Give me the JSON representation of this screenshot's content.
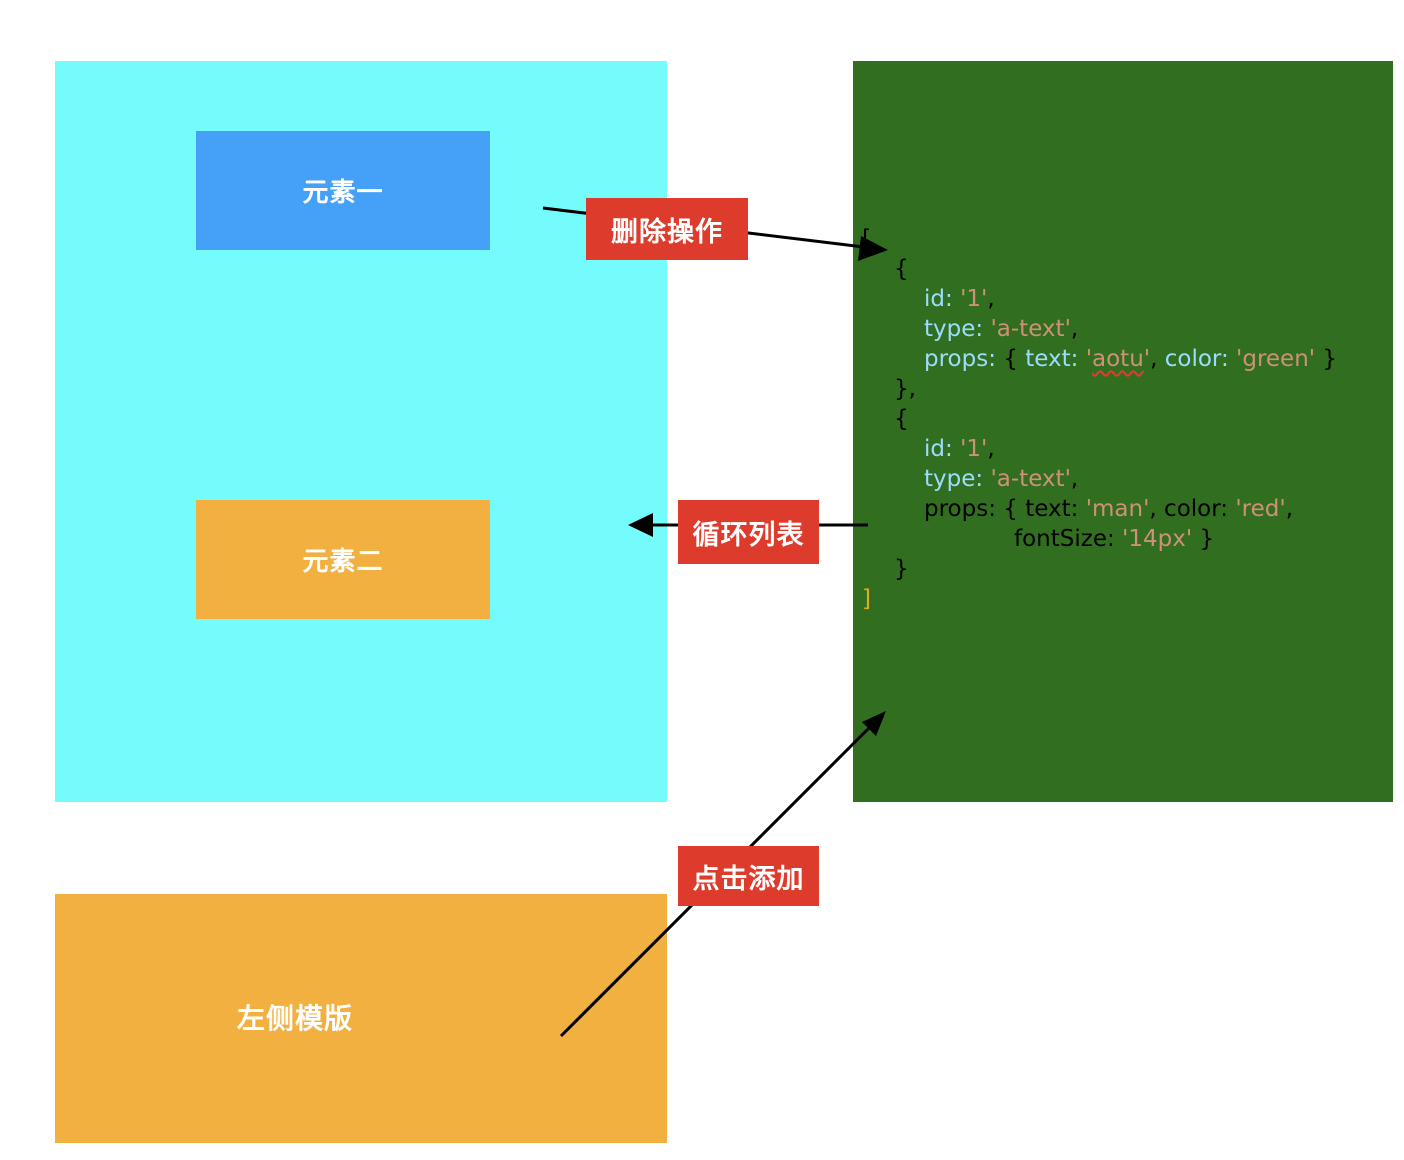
{
  "canvas": {
    "element_one_label": "元素一",
    "element_two_label": "元素二"
  },
  "template": {
    "label": "左侧模版"
  },
  "edges": {
    "delete_label": "删除操作",
    "loop_label": "循环列表",
    "add_label": "点击添加"
  },
  "code": {
    "open_bracket": "[",
    "close_bracket": "]",
    "item1": {
      "open": "{",
      "id_key": "id: ",
      "id_val": "'1'",
      "type_key": "type: ",
      "type_val": "'a-text'",
      "props_key": "props: ",
      "text_key": "text: ",
      "text_val": "'aotu'",
      "color_key": "color: ",
      "color_val": "'green'",
      "close": "},"
    },
    "item2": {
      "open": "{",
      "id_key": "id: ",
      "id_val": "'1'",
      "type_key": "type: ",
      "type_val": "'a-text'",
      "props_key": "props: ",
      "text_key": "text: ",
      "text_val": "'man'",
      "color_key": "color: ",
      "color_val": "'red'",
      "font_key": "fontSize: ",
      "font_val": "'14px'",
      "close": "}"
    }
  },
  "colors": {
    "canvas_bg": "#74fbfc",
    "element_one_bg": "#45a1f8",
    "element_two_bg": "#f2b041",
    "data_panel_bg": "#326e1f",
    "template_bg": "#f2b041",
    "label_bg": "#dd3b2c",
    "code_key": "#9cdcfe",
    "code_string": "#ce9178"
  }
}
